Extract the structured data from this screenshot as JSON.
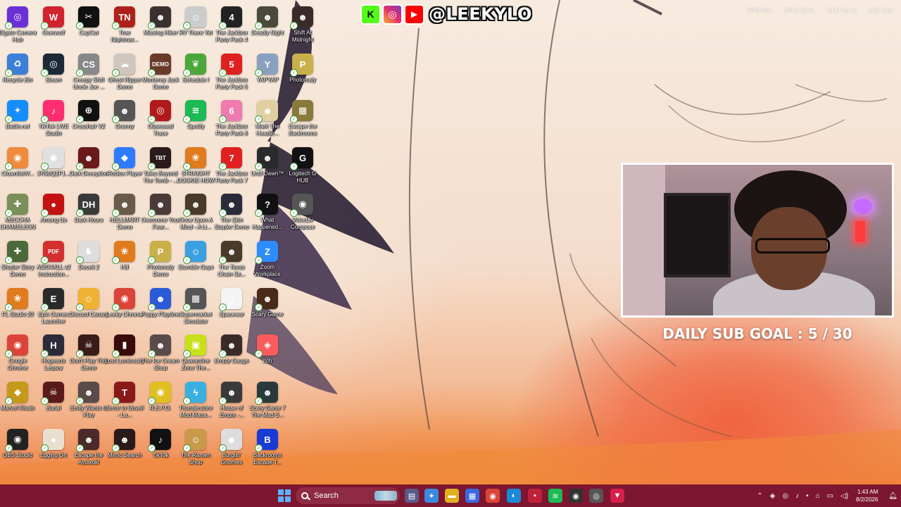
{
  "desktop": {
    "columns": [
      [
        {
          "label": "Elgato Camera Hub",
          "icon": "elgato-icon",
          "color": "#6b2fd6",
          "glyph": "◎"
        },
        {
          "label": "Recycle Bin",
          "icon": "recycle-bin-icon",
          "color": "#3d7fd6",
          "glyph": "♻"
        },
        {
          "label": "Battle.net",
          "icon": "battlenet-icon",
          "color": "#148eff",
          "glyph": "✦"
        },
        {
          "label": "ClownfishV...",
          "icon": "clownfish-icon",
          "color": "#f08a3c",
          "glyph": "◉"
        },
        {
          "label": "MECCHA CHAMELEON",
          "icon": "chameleon-icon",
          "color": "#7a8f5a",
          "glyph": "✚"
        },
        {
          "label": "Shutter Story Demo",
          "icon": "shutter-story-icon",
          "color": "#4a6a3a",
          "glyph": "✚"
        },
        {
          "label": "FL Studio 20",
          "icon": "flstudio-icon",
          "color": "#e07b1e",
          "glyph": "❀"
        },
        {
          "label": "Google Chrome",
          "icon": "chrome-icon",
          "color": "#db4437",
          "glyph": "◉"
        },
        {
          "label": "Marvel Rivals",
          "icon": "marvel-rivals-icon",
          "color": "#c59a1a",
          "glyph": "◆"
        },
        {
          "label": "OBS Studio",
          "icon": "obs-icon",
          "color": "#222",
          "glyph": "◉"
        }
      ],
      [
        {
          "label": "Overwolf",
          "icon": "overwolf-icon",
          "color": "#d1242f",
          "glyph": "W"
        },
        {
          "label": "Steam",
          "icon": "steam-icon",
          "color": "#1b2838",
          "glyph": "◎"
        },
        {
          "label": "TikTok LIVE Studio",
          "icon": "tiktok-live-icon",
          "color": "#ff2d6f",
          "glyph": "♪"
        },
        {
          "label": "37i9dQZF1...",
          "icon": "chrome-shortcut-icon",
          "color": "#e0e0e0",
          "glyph": "◉"
        },
        {
          "label": "Among Us",
          "icon": "among-us-icon",
          "color": "#c51111",
          "glyph": "●"
        },
        {
          "label": "ASIO4ALL v2 Instruction...",
          "icon": "pdf-icon",
          "color": "#d32f2f",
          "glyph": "PDF"
        },
        {
          "label": "Epic Games Launcher",
          "icon": "epic-games-icon",
          "color": "#2a2a2a",
          "glyph": "E"
        },
        {
          "label": "Hogwarts Legacy",
          "icon": "hogwarts-icon",
          "color": "#2b2b3a",
          "glyph": "H"
        },
        {
          "label": "Burial",
          "icon": "burial-icon",
          "color": "#5a1a1a",
          "glyph": "☠"
        },
        {
          "label": "Egging On",
          "icon": "egging-on-icon",
          "color": "#e8dfcf",
          "glyph": "●"
        }
      ],
      [
        {
          "label": "CapCut",
          "icon": "capcut-icon",
          "color": "#111",
          "glyph": "✂"
        },
        {
          "label": "Creepy Shift Uncle Joe ...",
          "icon": "creepy-shift-icon",
          "color": "#888",
          "glyph": "CS"
        },
        {
          "label": "Crosshair V2",
          "icon": "crosshair-icon",
          "color": "#111",
          "glyph": "⊕"
        },
        {
          "label": "Dark Deception",
          "icon": "dark-deception-icon",
          "color": "#6a1a1a",
          "glyph": "☻"
        },
        {
          "label": "Dark Hours",
          "icon": "dark-hours-icon",
          "color": "#3a3a3a",
          "glyph": "DH"
        },
        {
          "label": "Deceit 2",
          "icon": "deceit-icon",
          "color": "#ddd",
          "glyph": "♞"
        },
        {
          "label": "Discord Canary",
          "icon": "discord-icon",
          "color": "#f0b232",
          "glyph": "☺"
        },
        {
          "label": "Don't Play This Demo",
          "icon": "dont-play-icon",
          "color": "#3a1a1a",
          "glyph": "☠"
        },
        {
          "label": "Emily Wants to Play",
          "icon": "emily-icon",
          "color": "#5a4a4a",
          "glyph": "☻"
        },
        {
          "label": "Escape the Ayuwoki",
          "icon": "ayuwoki-icon",
          "color": "#4a2a2a",
          "glyph": "☻"
        }
      ],
      [
        {
          "label": "True Nightmar...",
          "icon": "true-nightmare-icon",
          "color": "#b0201a",
          "glyph": "TN"
        },
        {
          "label": "Ghost Ripper Demo",
          "icon": "ghost-ripper-icon",
          "color": "#cfc6c0",
          "glyph": "☁"
        },
        {
          "label": "Granny",
          "icon": "granny-icon",
          "color": "#555",
          "glyph": "☻"
        },
        {
          "label": "Roblox Player",
          "icon": "roblox-icon",
          "color": "#2f7bff",
          "glyph": "◆"
        },
        {
          "label": "HELLMART Demo",
          "icon": "hellmart-icon",
          "color": "#6a5a4a",
          "glyph": "☻"
        },
        {
          "label": "Hill",
          "icon": "hill-icon",
          "color": "#e07b1e",
          "glyph": "❀"
        },
        {
          "label": "Leeky Chrome",
          "icon": "leeky-chrome-icon",
          "color": "#db4437",
          "glyph": "◉"
        },
        {
          "label": "Lost Luminosity",
          "icon": "lost-luminosity-icon",
          "color": "#3a0a0a",
          "glyph": "▮"
        },
        {
          "label": "Terror to Unveil - La...",
          "icon": "terror-icon",
          "color": "#8a1a1a",
          "glyph": "T"
        },
        {
          "label": "Mimic Search",
          "icon": "mimic-icon",
          "color": "#2a1a1a",
          "glyph": "☻"
        }
      ],
      [
        {
          "label": "Missing Hiker",
          "icon": "missing-hiker-icon",
          "color": "#3a3030",
          "glyph": "☻"
        },
        {
          "label": "Monterey Jack Demo",
          "icon": "monterey-icon",
          "color": "#6a3a2a",
          "glyph": "DEMO"
        },
        {
          "label": "Obsessed Trace",
          "icon": "obsessed-trace-icon",
          "color": "#b01a1a",
          "glyph": "◎"
        },
        {
          "label": "Tales Beyond The Tomb - ...",
          "icon": "tales-icon",
          "color": "#2a1a1a",
          "glyph": "TBT"
        },
        {
          "label": "Overcome Your Fear...",
          "icon": "overcome-icon",
          "color": "#4a3a3a",
          "glyph": "☻"
        },
        {
          "label": "Photomaly Demo",
          "icon": "photomaly-demo-icon",
          "color": "#c9b04a",
          "glyph": "P"
        },
        {
          "label": "Poppy Playtime",
          "icon": "poppy-icon",
          "color": "#2a5ad6",
          "glyph": "☻"
        },
        {
          "label": "The Ice Cream Shop",
          "icon": "ice-cream-icon",
          "color": "#5a4a4a",
          "glyph": "☻"
        },
        {
          "label": "R.E.P.O.",
          "icon": "repo-icon",
          "color": "#e0c020",
          "glyph": "◉"
        },
        {
          "label": "TikTok",
          "icon": "tiktok-icon",
          "color": "#111",
          "glyph": "♪"
        }
      ],
      [
        {
          "label": "RV There Yet",
          "icon": "rv-there-icon",
          "color": "#ccc",
          "glyph": "☺"
        },
        {
          "label": "Schedule I",
          "icon": "schedule-icon",
          "color": "#4aa83a",
          "glyph": "❦"
        },
        {
          "label": "Spotify",
          "icon": "spotify-icon",
          "color": "#1db954",
          "glyph": "≋"
        },
        {
          "label": "STRAIGHT DOOKIE HOW",
          "icon": "fl-straight-icon",
          "color": "#e07b1e",
          "glyph": "❀"
        },
        {
          "label": "Once Upon A Mind - A Li...",
          "icon": "once-upon-icon",
          "color": "#4a3a2a",
          "glyph": "☻"
        },
        {
          "label": "Stumble Guys",
          "icon": "stumble-icon",
          "color": "#3aa0e0",
          "glyph": "☺"
        },
        {
          "label": "Supermarket Simulator",
          "icon": "supermarket-icon",
          "color": "#555",
          "glyph": "▦"
        },
        {
          "label": "Quarantine Zone The...",
          "icon": "quarantine-icon",
          "color": "#c8e01a",
          "glyph": "▣"
        },
        {
          "label": "Thunderstore Mod Mana...",
          "icon": "thunderstore-icon",
          "color": "#3ab0e0",
          "glyph": "ϟ"
        },
        {
          "label": "The Ramen Shop",
          "icon": "ramen-icon",
          "color": "#c99a4a",
          "glyph": "☺"
        }
      ],
      [
        {
          "label": "The Jackbox Party Pack 4",
          "icon": "jackbox4-icon",
          "color": "#222",
          "glyph": "4"
        },
        {
          "label": "The Jackbox Party Pack 5",
          "icon": "jackbox5-icon",
          "color": "#e02020",
          "glyph": "5"
        },
        {
          "label": "The Jackbox Party Pack 6",
          "icon": "jackbox6-icon",
          "color": "#f07ab0",
          "glyph": "6"
        },
        {
          "label": "The Jackbox Party Pack 7",
          "icon": "jackbox7-icon",
          "color": "#e02020",
          "glyph": "7"
        },
        {
          "label": "The Skin Stapler Demo",
          "icon": "skin-stapler-icon",
          "color": "#2a2a3a",
          "glyph": "☻"
        },
        {
          "label": "The Texas Chain Sa...",
          "icon": "texas-icon",
          "color": "#4a3a2a",
          "glyph": "☻"
        },
        {
          "label": "Spacewar",
          "icon": "spacewar-icon",
          "color": "#f4f4f4",
          "glyph": "▯"
        },
        {
          "label": "Empty Gauge",
          "icon": "empty-gauge-icon",
          "color": "#3a2a2a",
          "glyph": "☻"
        },
        {
          "label": "House of Empty -...",
          "icon": "house-empty-icon",
          "color": "#3a3a3a",
          "glyph": "☻"
        },
        {
          "label": "Burglin' Gnomes",
          "icon": "burglin-icon",
          "color": "#ddd",
          "glyph": "☻"
        }
      ],
      [
        {
          "label": "Deadly Night",
          "icon": "deadly-night-icon",
          "color": "#4a4a3a",
          "glyph": "☻"
        },
        {
          "label": "YAPYAP",
          "icon": "yapyap-icon",
          "color": "#8aa0c0",
          "glyph": "Y"
        },
        {
          "label": "Mark The Headle...",
          "icon": "mark-headless-icon",
          "color": "#e0d0a0",
          "glyph": "☻"
        },
        {
          "label": "Until Dawn™",
          "icon": "until-dawn-icon",
          "color": "#2a2a2a",
          "glyph": "☻"
        },
        {
          "label": "What Happened...",
          "icon": "what-happened-icon",
          "color": "#111",
          "glyph": "?"
        },
        {
          "label": "Zoom Workplace",
          "icon": "zoom-icon",
          "color": "#2d8cff",
          "glyph": "Z"
        },
        {
          "label": "Scary Game",
          "icon": "scary-game-icon",
          "color": "#4a2a1a",
          "glyph": "☻"
        },
        {
          "label": "itch",
          "icon": "itch-icon",
          "color": "#fa5c5c",
          "glyph": "◈"
        },
        {
          "label": "Scary Game 7 The Mad S...",
          "icon": "scary-game-7-icon",
          "color": "#2a3a3a",
          "glyph": "☻"
        },
        {
          "label": "Backrooms Escape T...",
          "icon": "backrooms-escape-icon",
          "color": "#1a3ad6",
          "glyph": "B"
        }
      ],
      [
        {
          "label": "Shift At Midnight",
          "icon": "shift-midnight-icon",
          "color": "#3a2a2a",
          "glyph": "☻"
        },
        {
          "label": "Photomaly",
          "icon": "photomaly-icon",
          "color": "#c9b04a",
          "glyph": "P"
        },
        {
          "label": "Escape the Backrooms",
          "icon": "escape-backrooms-icon",
          "color": "#8a7a3a",
          "glyph": "▦"
        },
        {
          "label": "Logitech G HUB",
          "icon": "logitech-icon",
          "color": "#111",
          "glyph": "G"
        },
        {
          "label": "VoiceLiv Compose",
          "icon": "voicelive-icon",
          "color": "#555",
          "glyph": "◉"
        }
      ]
    ]
  },
  "banner": {
    "k_glyph": "K",
    "ig_glyph": "◎",
    "yt_glyph": "▶",
    "handle": "@LEEKYLO"
  },
  "stats": {
    "fps": "FPS N/A",
    "gpu": "GPU 26 %",
    "cpu": "CPU 16 %",
    "lat": "LAT N/A"
  },
  "webcam": {
    "sub_goal": "DAILY SUB GOAL : 5 / 30"
  },
  "taskbar": {
    "search_label": "Search",
    "pinned": [
      {
        "name": "file-explorer",
        "glyph": "▤",
        "color": "#5a5a8a"
      },
      {
        "name": "copilot",
        "glyph": "✦",
        "color": "#3a8ae0"
      },
      {
        "name": "folder",
        "glyph": "▬",
        "color": "#e0b020"
      },
      {
        "name": "store",
        "glyph": "▦",
        "color": "#3a6ae0"
      },
      {
        "name": "chrome",
        "glyph": "◉",
        "color": "#db4437"
      },
      {
        "name": "edge",
        "glyph": "◐",
        "color": "#1a8ad6"
      },
      {
        "name": "red-app",
        "glyph": "▪",
        "color": "#c0203a"
      },
      {
        "name": "spotify",
        "glyph": "≋",
        "color": "#1db954"
      },
      {
        "name": "obs",
        "glyph": "◉",
        "color": "#333"
      },
      {
        "name": "steam",
        "glyph": "◎",
        "color": "#555"
      },
      {
        "name": "streamlabs",
        "glyph": "▼",
        "color": "#d6204a"
      }
    ],
    "clock_time": "1:43 AM",
    "clock_date": "8/2/2026"
  }
}
